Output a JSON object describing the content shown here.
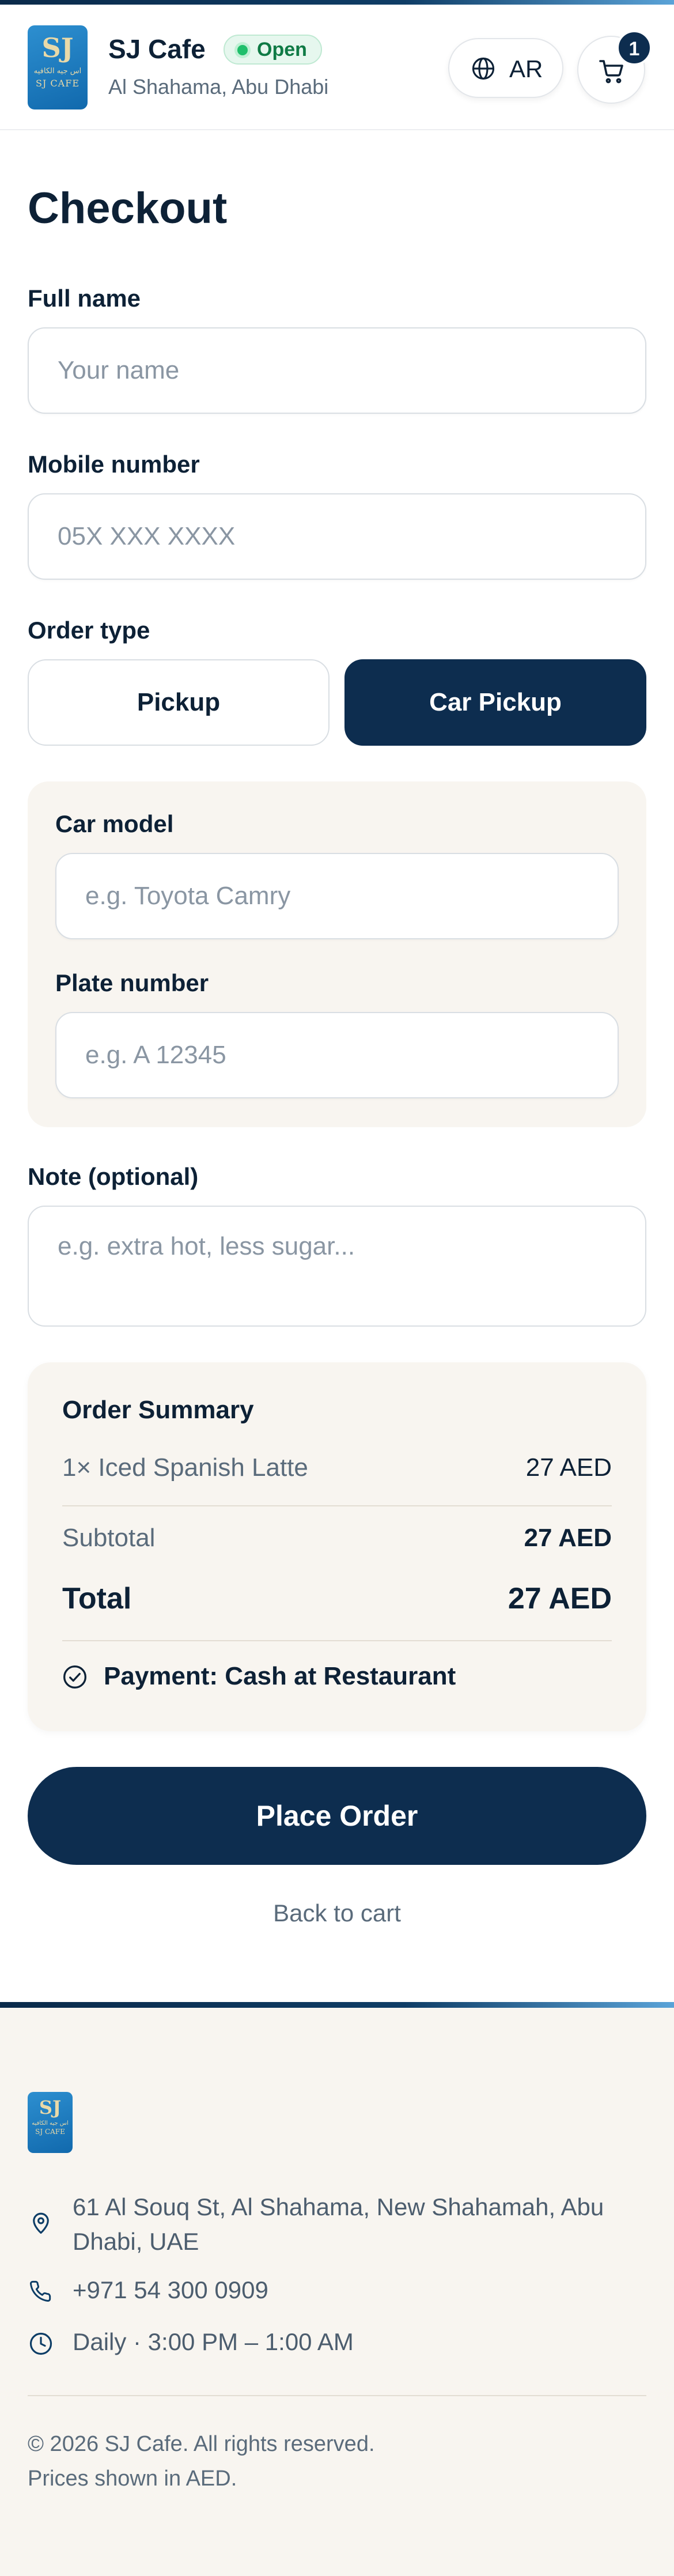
{
  "header": {
    "shop_name": "SJ Cafe",
    "status": "Open",
    "location": "Al Shahama, Abu Dhabi",
    "language_button": "AR",
    "cart_count": "1",
    "logo": {
      "monogram": "SJ",
      "arabic": "اس جيه الكافيه",
      "english": "SJ CAFE"
    }
  },
  "checkout": {
    "title": "Checkout",
    "full_name": {
      "label": "Full name",
      "placeholder": "Your name"
    },
    "mobile": {
      "label": "Mobile number",
      "placeholder": "05X XXX XXXX"
    },
    "order_type": {
      "label": "Order type",
      "options": [
        "Pickup",
        "Car Pickup"
      ],
      "selected": "Car Pickup"
    },
    "car_model": {
      "label": "Car model",
      "placeholder": "e.g. Toyota Camry"
    },
    "plate_number": {
      "label": "Plate number",
      "placeholder": "e.g. A 12345"
    },
    "note": {
      "label": "Note (optional)",
      "placeholder": "e.g. extra hot, less sugar..."
    }
  },
  "summary": {
    "title": "Order Summary",
    "item_name": "1× Iced Spanish Latte",
    "item_price": "27 AED",
    "subtotal_label": "Subtotal",
    "subtotal_value": "27 AED",
    "total_label": "Total",
    "total_value": "27 AED",
    "payment": "Payment: Cash at Restaurant"
  },
  "actions": {
    "place_order": "Place Order",
    "back_to_cart": "Back to cart"
  },
  "footer": {
    "address": "61 Al Souq St, Al Shahama, New Shahamah, Abu Dhabi, UAE",
    "phone": "+971 54 300 0909",
    "hours": "Daily · 3:00 PM – 1:00 AM",
    "copyright": "© 2026 SJ Cafe. All rights reserved.",
    "currency_note": "Prices shown in AED."
  },
  "colors": {
    "primary": "#0d2d4f",
    "open_green": "#1fbf6b",
    "panel_bg": "#f8f5f0"
  }
}
